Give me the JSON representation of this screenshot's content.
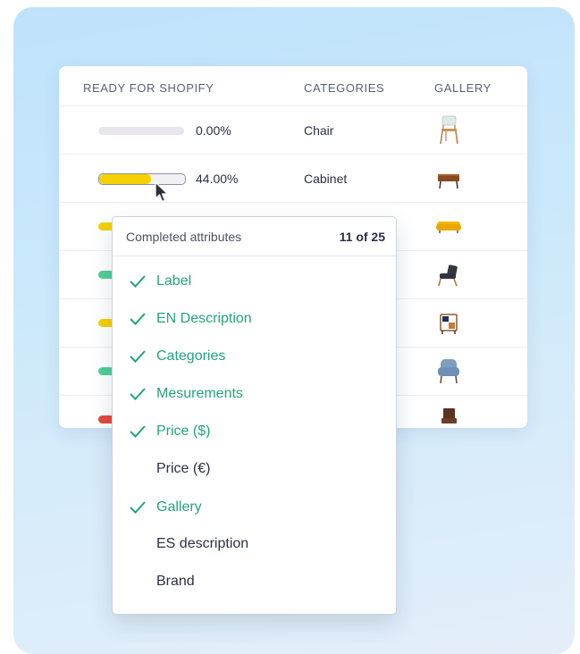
{
  "table": {
    "headers": {
      "ready": "READY FOR SHOPIFY",
      "categories": "CATEGORIES",
      "gallery": "GALLERY"
    },
    "rows": [
      {
        "progress": 0.0,
        "percent_text": "0.00%",
        "category": "Chair",
        "bar_color": "#e9e5ee",
        "thumb": "white-chair-thumbnail"
      },
      {
        "progress": 44.0,
        "percent_text": "44.00%",
        "category": "Cabinet",
        "bar_color": "#f5d100",
        "thumb": "cabinet-thumbnail"
      },
      {
        "bar_color": "#f5d100",
        "thumb": "yellow-sofa-thumbnail"
      },
      {
        "bar_color": "#4fcf9a",
        "thumb": "armchair-thumbnail"
      },
      {
        "bar_color": "#f5d100",
        "thumb": "shelf-thumbnail"
      },
      {
        "bar_color": "#4fcf9a",
        "thumb": "blue-armchair-thumbnail"
      },
      {
        "bar_color": "#e5473d",
        "thumb": "wood-chair-thumbnail"
      }
    ]
  },
  "popup": {
    "title": "Completed attributes",
    "count": "11 of 25",
    "attributes": [
      {
        "label": "Label",
        "completed": true
      },
      {
        "label": "EN Description",
        "completed": true
      },
      {
        "label": "Categories",
        "completed": true
      },
      {
        "label": "Mesurements",
        "completed": true
      },
      {
        "label": "Price ($)",
        "completed": true
      },
      {
        "label": "Price (€)",
        "completed": false
      },
      {
        "label": "Gallery",
        "completed": true
      },
      {
        "label": "ES description",
        "completed": false
      },
      {
        "label": "Brand",
        "completed": false
      }
    ]
  },
  "colors": {
    "completed": "#21a57b",
    "yellow": "#f5d100",
    "green": "#4fcf9a",
    "red": "#e5473d"
  }
}
